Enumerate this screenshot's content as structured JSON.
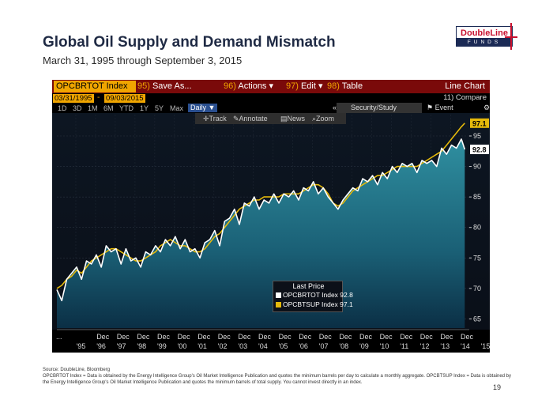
{
  "page": {
    "title": "Global Oil Supply and Demand Mismatch",
    "subtitle": "March 31, 1995 through September 3, 2015",
    "logo_top": "DoubleLine",
    "logo_bottom": "FUNDS",
    "footer_source": "Source: DoubleLine, Bloomberg",
    "footer_note": "OPCBRTOT Index = Data is obtained by the Energy Intelligence Group's Oil Market Intelligence Publication and quotes the minimum barrels per day to calculate a monthly aggregate. OPCBTSUP Index = Data is obtained by the Energy Intelligence Group's Oil Market Intelligence Publication and quotes the minimum barrels of total supply. You cannot invest directly in an index.",
    "page_number": "19"
  },
  "terminal": {
    "ticker": "OPCBRTOT Index",
    "menu": [
      {
        "num": "95)",
        "label": "Save As...",
        "x": 108
      },
      {
        "num": "96)",
        "label": "Actions ▾",
        "x": 217
      },
      {
        "num": "97)",
        "label": "Edit ▾",
        "x": 296
      },
      {
        "num": "98)",
        "label": "Table",
        "x": 348
      }
    ],
    "chart_mode": "Line Chart",
    "start_date": "03/31/1995",
    "end_date": "09/03/2015",
    "compare": "11) Compare",
    "periods": [
      "1D",
      "3D",
      "1M",
      "6M",
      "YTD",
      "1Y",
      "5Y",
      "Max"
    ],
    "frequency": "Daily ▼",
    "security_study": "Security/Study",
    "event": "Event",
    "collapse": "«",
    "gear": "⚙",
    "tools": [
      "Track",
      "Annotate",
      "News",
      "Zoom"
    ],
    "legend_title": "Last Price",
    "legend_rows": [
      {
        "label": "OPCBRTOT Index",
        "value": "92.8"
      },
      {
        "label": "OPCBTSUP Index",
        "value": "97.1"
      }
    ]
  },
  "chart_data": {
    "type": "line",
    "title": "",
    "xlabel": "",
    "ylabel": "",
    "x_tick_labels": [
      "...",
      "'95",
      "Dec '96",
      "Dec '97",
      "Dec '98",
      "Dec '99",
      "Dec '00",
      "Dec '01",
      "Dec '02",
      "Dec '03",
      "Dec '04",
      "Dec '05",
      "Dec '06",
      "Dec '07",
      "Dec '08",
      "Dec '09",
      "Dec '10",
      "Dec '11",
      "Dec '12",
      "Dec '13",
      "Dec '14",
      "'15"
    ],
    "y_ticks": [
      65,
      70,
      75,
      80,
      85,
      90,
      95
    ],
    "ylim": [
      63.5,
      98.5
    ],
    "xlim": [
      1995.0,
      2015.9
    ],
    "last_values": {
      "OPCBRTOT Index": 92.8,
      "OPCBTSUP Index": 97.1
    },
    "series": [
      {
        "name": "OPCBRTOT Index",
        "color": "#ffffff",
        "fill": true,
        "points": [
          [
            1995.0,
            69.8
          ],
          [
            1995.25,
            68.0
          ],
          [
            1995.5,
            71.5
          ],
          [
            1995.75,
            72.5
          ],
          [
            1996.0,
            73.5
          ],
          [
            1996.25,
            71.5
          ],
          [
            1996.5,
            74.5
          ],
          [
            1996.75,
            74.0
          ],
          [
            1997.0,
            75.5
          ],
          [
            1997.25,
            73.5
          ],
          [
            1997.5,
            77.0
          ],
          [
            1997.75,
            76.0
          ],
          [
            1998.0,
            76.5
          ],
          [
            1998.25,
            74.0
          ],
          [
            1998.5,
            76.5
          ],
          [
            1998.75,
            74.5
          ],
          [
            1999.0,
            75.0
          ],
          [
            1999.25,
            73.5
          ],
          [
            1999.5,
            76.0
          ],
          [
            1999.75,
            75.5
          ],
          [
            2000.0,
            77.0
          ],
          [
            2000.25,
            76.0
          ],
          [
            2000.5,
            78.0
          ],
          [
            2000.75,
            77.0
          ],
          [
            2001.0,
            78.5
          ],
          [
            2001.25,
            76.5
          ],
          [
            2001.5,
            78.0
          ],
          [
            2001.75,
            76.0
          ],
          [
            2002.0,
            76.5
          ],
          [
            2002.25,
            75.0
          ],
          [
            2002.5,
            77.5
          ],
          [
            2002.75,
            78.0
          ],
          [
            2003.0,
            79.5
          ],
          [
            2003.25,
            77.0
          ],
          [
            2003.5,
            81.0
          ],
          [
            2003.75,
            81.5
          ],
          [
            2004.0,
            83.0
          ],
          [
            2004.25,
            80.5
          ],
          [
            2004.5,
            84.0
          ],
          [
            2004.75,
            83.5
          ],
          [
            2005.0,
            85.0
          ],
          [
            2005.25,
            83.0
          ],
          [
            2005.5,
            84.5
          ],
          [
            2005.75,
            84.0
          ],
          [
            2006.0,
            85.5
          ],
          [
            2006.25,
            84.0
          ],
          [
            2006.5,
            85.5
          ],
          [
            2006.75,
            85.0
          ],
          [
            2007.0,
            86.0
          ],
          [
            2007.25,
            84.5
          ],
          [
            2007.5,
            86.5
          ],
          [
            2007.75,
            86.0
          ],
          [
            2008.0,
            87.5
          ],
          [
            2008.25,
            85.5
          ],
          [
            2008.5,
            86.5
          ],
          [
            2008.75,
            85.0
          ],
          [
            2009.0,
            84.0
          ],
          [
            2009.25,
            83.0
          ],
          [
            2009.5,
            84.5
          ],
          [
            2009.75,
            85.5
          ],
          [
            2010.0,
            86.5
          ],
          [
            2010.25,
            86.0
          ],
          [
            2010.5,
            88.0
          ],
          [
            2010.75,
            87.5
          ],
          [
            2011.0,
            88.5
          ],
          [
            2011.25,
            87.0
          ],
          [
            2011.5,
            89.0
          ],
          [
            2011.75,
            88.0
          ],
          [
            2012.0,
            90.0
          ],
          [
            2012.25,
            89.0
          ],
          [
            2012.5,
            90.5
          ],
          [
            2012.75,
            90.0
          ],
          [
            2013.0,
            90.5
          ],
          [
            2013.25,
            89.0
          ],
          [
            2013.5,
            91.0
          ],
          [
            2013.75,
            90.5
          ],
          [
            2014.0,
            91.0
          ],
          [
            2014.25,
            90.0
          ],
          [
            2014.5,
            93.0
          ],
          [
            2014.75,
            92.0
          ],
          [
            2015.0,
            93.5
          ],
          [
            2015.25,
            93.0
          ],
          [
            2015.5,
            94.5
          ],
          [
            2015.67,
            92.8
          ]
        ]
      },
      {
        "name": "OPCBTSUP Index",
        "color": "#e5b90b",
        "fill": false,
        "points": [
          [
            1995.0,
            70.0
          ],
          [
            1995.25,
            70.5
          ],
          [
            1995.5,
            71.5
          ],
          [
            1995.75,
            72.0
          ],
          [
            1996.0,
            73.0
          ],
          [
            1996.25,
            72.5
          ],
          [
            1996.5,
            73.5
          ],
          [
            1996.75,
            74.5
          ],
          [
            1997.0,
            75.0
          ],
          [
            1997.25,
            75.5
          ],
          [
            1997.5,
            76.0
          ],
          [
            1997.75,
            76.5
          ],
          [
            1998.0,
            76.5
          ],
          [
            1998.25,
            76.0
          ],
          [
            1998.5,
            75.5
          ],
          [
            1998.75,
            75.0
          ],
          [
            1999.0,
            74.5
          ],
          [
            1999.25,
            74.5
          ],
          [
            1999.5,
            75.0
          ],
          [
            1999.75,
            75.5
          ],
          [
            2000.0,
            76.0
          ],
          [
            2000.25,
            77.0
          ],
          [
            2000.5,
            77.5
          ],
          [
            2000.75,
            78.0
          ],
          [
            2001.0,
            77.5
          ],
          [
            2001.25,
            77.0
          ],
          [
            2001.5,
            77.0
          ],
          [
            2001.75,
            76.5
          ],
          [
            2002.0,
            76.0
          ],
          [
            2002.25,
            76.0
          ],
          [
            2002.5,
            76.5
          ],
          [
            2002.75,
            77.5
          ],
          [
            2003.0,
            78.5
          ],
          [
            2003.25,
            79.0
          ],
          [
            2003.5,
            80.0
          ],
          [
            2003.75,
            81.0
          ],
          [
            2004.0,
            82.0
          ],
          [
            2004.25,
            83.0
          ],
          [
            2004.5,
            83.5
          ],
          [
            2004.75,
            84.0
          ],
          [
            2005.0,
            84.5
          ],
          [
            2005.25,
            84.5
          ],
          [
            2005.5,
            85.0
          ],
          [
            2005.75,
            85.0
          ],
          [
            2006.0,
            85.0
          ],
          [
            2006.25,
            85.0
          ],
          [
            2006.5,
            85.5
          ],
          [
            2006.75,
            85.5
          ],
          [
            2007.0,
            85.5
          ],
          [
            2007.25,
            85.5
          ],
          [
            2007.5,
            86.0
          ],
          [
            2007.75,
            86.5
          ],
          [
            2008.0,
            87.0
          ],
          [
            2008.25,
            87.0
          ],
          [
            2008.5,
            86.5
          ],
          [
            2008.75,
            85.5
          ],
          [
            2009.0,
            84.0
          ],
          [
            2009.25,
            83.5
          ],
          [
            2009.5,
            84.0
          ],
          [
            2009.75,
            85.0
          ],
          [
            2010.0,
            86.0
          ],
          [
            2010.25,
            86.5
          ],
          [
            2010.5,
            87.0
          ],
          [
            2010.75,
            87.5
          ],
          [
            2011.0,
            88.0
          ],
          [
            2011.25,
            88.5
          ],
          [
            2011.5,
            88.5
          ],
          [
            2011.75,
            89.0
          ],
          [
            2012.0,
            89.5
          ],
          [
            2012.25,
            90.0
          ],
          [
            2012.5,
            90.0
          ],
          [
            2012.75,
            90.0
          ],
          [
            2013.0,
            90.0
          ],
          [
            2013.25,
            90.0
          ],
          [
            2013.5,
            90.5
          ],
          [
            2013.75,
            91.0
          ],
          [
            2014.0,
            91.5
          ],
          [
            2014.25,
            92.0
          ],
          [
            2014.5,
            92.5
          ],
          [
            2014.75,
            93.5
          ],
          [
            2015.0,
            94.5
          ],
          [
            2015.25,
            95.5
          ],
          [
            2015.5,
            96.5
          ],
          [
            2015.67,
            97.1
          ]
        ]
      }
    ]
  }
}
